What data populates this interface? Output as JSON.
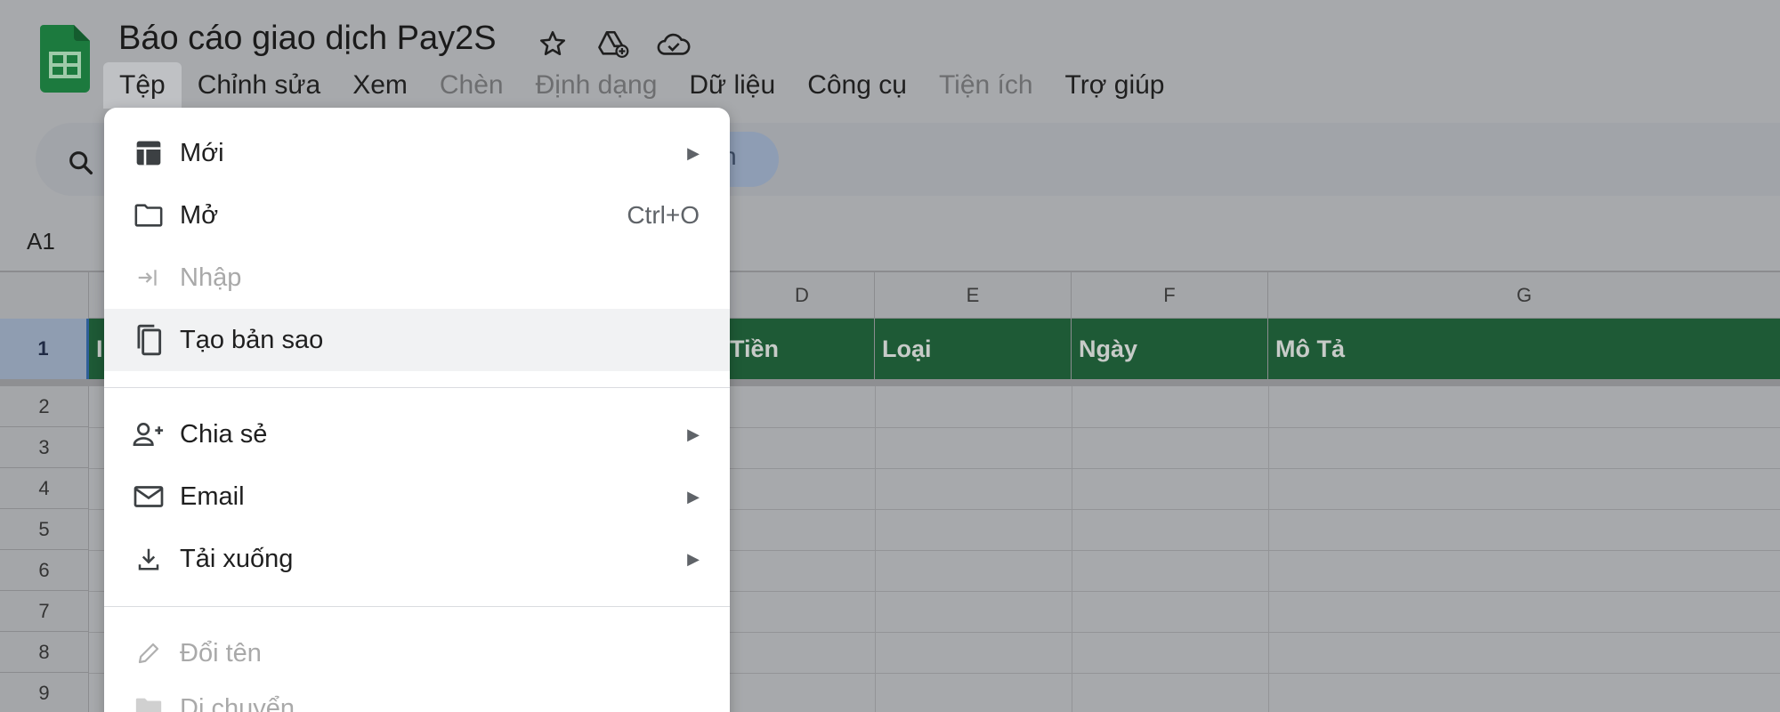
{
  "doc": {
    "title": "Báo cáo giao dịch Pay2S"
  },
  "menubar": [
    {
      "label": "Tệp",
      "state": "active"
    },
    {
      "label": "Chỉnh sửa",
      "state": "normal"
    },
    {
      "label": "Xem",
      "state": "normal"
    },
    {
      "label": "Chèn",
      "state": "disabled"
    },
    {
      "label": "Định dạng",
      "state": "disabled"
    },
    {
      "label": "Dữ liệu",
      "state": "normal"
    },
    {
      "label": "Công cụ",
      "state": "normal"
    },
    {
      "label": "Tiện ích",
      "state": "disabled"
    },
    {
      "label": "Trợ giúp",
      "state": "normal"
    }
  ],
  "toolbar": {
    "chip_text": "n"
  },
  "formula": {
    "cell_ref": "A1"
  },
  "sheet": {
    "columns": [
      "D",
      "E",
      "F",
      "G"
    ],
    "header_row_number": "1",
    "header_cells": [
      "I",
      "Tiền",
      "Loại",
      "Ngày",
      "Mô Tả"
    ],
    "row_numbers": [
      "2",
      "3",
      "4",
      "5",
      "6",
      "7",
      "8",
      "9"
    ]
  },
  "file_menu": {
    "items": [
      {
        "label": "Mới",
        "icon": "new-sheet-icon",
        "arrow": "▶"
      },
      {
        "label": "Mở",
        "icon": "folder-icon",
        "shortcut": "Ctrl+O"
      },
      {
        "label": "Nhập",
        "icon": "import-icon",
        "disabled": true
      },
      {
        "label": "Tạo bản sao",
        "icon": "copy-icon"
      },
      {
        "label": "Chia sẻ",
        "icon": "person-add-icon",
        "arrow": "▶"
      },
      {
        "label": "Email",
        "icon": "mail-icon",
        "arrow": "▶"
      },
      {
        "label": "Tải xuống",
        "icon": "download-icon",
        "arrow": "▶"
      },
      {
        "label": "Đổi tên",
        "icon": "pencil-icon",
        "disabled": true
      },
      {
        "label": "Di chuyển",
        "icon": "folder-move-icon",
        "disabled": true
      }
    ]
  }
}
